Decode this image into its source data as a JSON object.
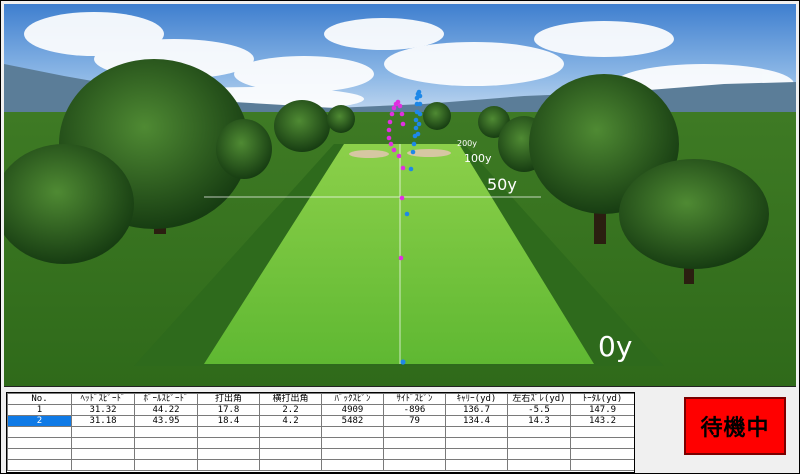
{
  "range": {
    "distance_labels": [
      "200y",
      "100y",
      "50y",
      "0y"
    ],
    "colors": {
      "shot1": "#e030e0",
      "shot2": "#1e88e8"
    }
  },
  "shot_table": {
    "headers": [
      "No.",
      "ﾍｯﾄﾞｽﾋﾟｰﾄﾞ",
      "ﾎﾞｰﾙｽﾋﾟｰﾄﾞ",
      "打出角",
      "横打出角",
      "ﾊﾞｯｸｽﾋﾟﾝ",
      "ｻｲﾄﾞｽﾋﾟﾝ",
      "ｷｬﾘｰ(yd)",
      "左右ｽﾞﾚ(yd)",
      "ﾄｰﾀﾙ(yd)"
    ],
    "rows": [
      [
        "1",
        "31.32",
        "44.22",
        "17.8",
        "2.2",
        "4909",
        "-896",
        "136.7",
        "-5.5",
        "147.9"
      ],
      [
        "2",
        "31.18",
        "43.95",
        "18.4",
        "4.2",
        "5482",
        "79",
        "134.4",
        "14.3",
        "143.2"
      ]
    ]
  },
  "status_button": {
    "label": "待機中"
  }
}
